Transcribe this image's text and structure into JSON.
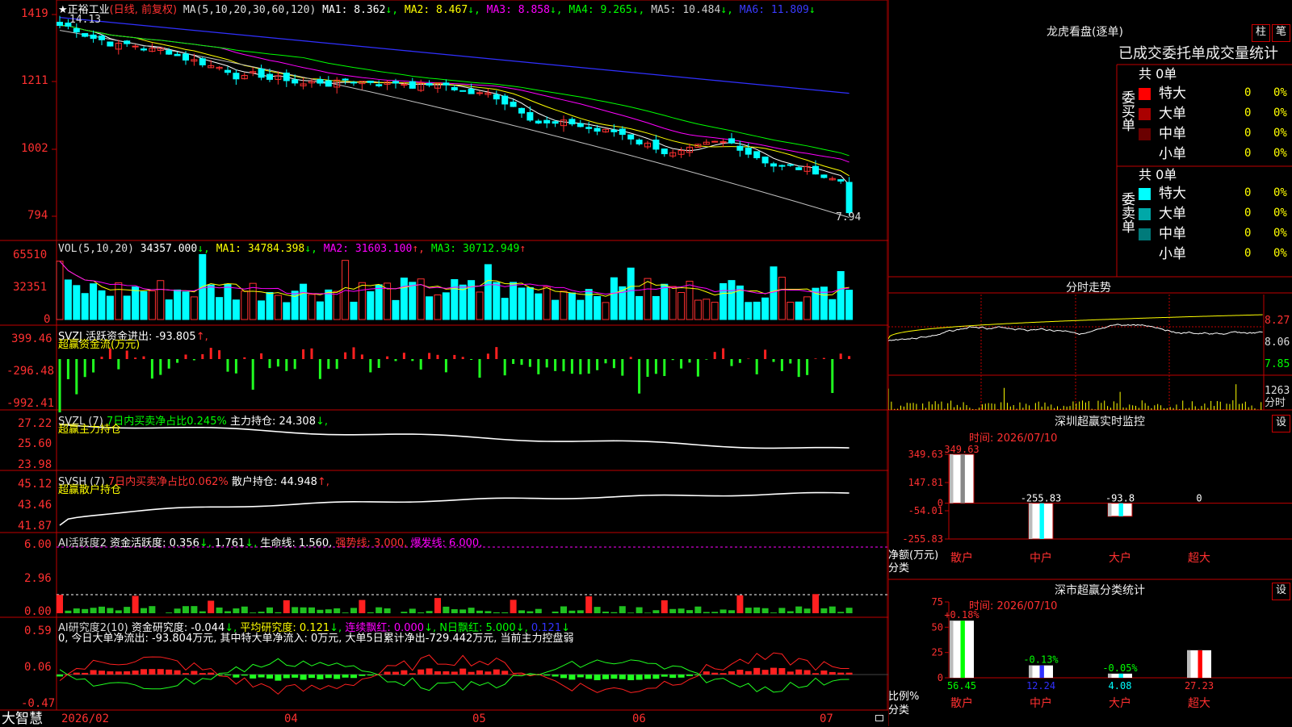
{
  "app": {
    "name": "大智慧"
  },
  "main": {
    "stock_title": "正裕工业",
    "period": "(日线, 前复权)",
    "star": "★",
    "ma_header": "MA(5,10,20,30,60,120)",
    "ma_items": [
      {
        "label": "MA1: 8.362",
        "color": "#ffffff"
      },
      {
        "label": "MA2: 8.467",
        "color": "#ffff00"
      },
      {
        "label": "MA3: 8.858",
        "color": "#ff00ff"
      },
      {
        "label": "MA4: 9.265",
        "color": "#00ff00"
      },
      {
        "label": "MA5: 10.484",
        "color": "#c0c0c0"
      },
      {
        "label": "MA6: 11.809",
        "color": "#3030ff"
      }
    ],
    "y_ticks": [
      "1419",
      "1211",
      "1002",
      "794"
    ],
    "high_marker": "14.13",
    "low_marker": "7.94"
  },
  "vol": {
    "header": "VOL(5,10,20)",
    "value": "34357.000",
    "ma1": "MA1: 34784.398",
    "ma2": "MA2: 31603.100",
    "ma3": "MA3: 30712.949",
    "y_ticks": [
      "65510",
      "32351",
      "0"
    ]
  },
  "svzj": {
    "header": "SVZJ  活跃资金进出: -93.805",
    "subtitle": "超赢资金流(万元)",
    "y_ticks": [
      "399.46",
      "-296.48",
      "-992.41"
    ]
  },
  "svzl": {
    "header": "SVZL (7)",
    "ratio": "7日内买卖净占比0.245%",
    "holding": "主力持仓: 24.308",
    "subtitle": "超赢主力持仓",
    "y_ticks": [
      "27.22",
      "25.60",
      "23.98"
    ]
  },
  "svsh": {
    "header": "SVSH (7)",
    "ratio": "7日内买卖净占比0.062%",
    "holding": "散户持仓: 44.948",
    "subtitle": "超赢散户持仓",
    "y_ticks": [
      "45.12",
      "43.46",
      "41.87"
    ]
  },
  "ai_active": {
    "header": "AI活跃度2",
    "item1": "资金活跃度: 0.356",
    "item2": "1.761",
    "item3": "生命线: 1.560,",
    "item4": "强势线: 3.000,",
    "item5": "爆发线: 6.000,",
    "y_ticks": [
      "6.00",
      "2.96",
      "0.00"
    ]
  },
  "ai_research": {
    "header": "AI研究度2(10)",
    "item1": "资金研究度: -0.044",
    "item2": "平均研究度: 0.121",
    "item3": "连续飘红: 0.000",
    "item4": "N日飘红: 5.000",
    "item5": "0.121",
    "comment": "0, 今日大单净流出: -93.804万元, 其中特大单净流入: 0万元, 大单5日累计净出-729.442万元, 当前主力控盘弱",
    "y_ticks": [
      "0.59",
      "0.06",
      "-0.47"
    ]
  },
  "x_axis": {
    "labels": [
      "2026/02",
      "04",
      "05",
      "06",
      "07"
    ]
  },
  "dragon": {
    "title": "龙虎看盘(逐单)",
    "btn_bar": "柱",
    "btn_pen": "笔",
    "tabs": "已成交委托单成交量统计",
    "buy_side": "委买单",
    "sell_side": "委卖单",
    "buy_total": "共 0单",
    "sell_total": "共 0单",
    "buy_rows": [
      {
        "label": "特大",
        "count": "0",
        "pct": "0%",
        "color": "#ff0000"
      },
      {
        "label": "大单",
        "count": "0",
        "pct": "0%",
        "color": "#aa0000"
      },
      {
        "label": "中单",
        "count": "0",
        "pct": "0%",
        "color": "#6a0000"
      },
      {
        "label": "小单",
        "count": "0",
        "pct": "0%",
        "color": "#000000"
      }
    ],
    "sell_rows": [
      {
        "label": "特大",
        "count": "0",
        "pct": "0%",
        "color": "#00ffff"
      },
      {
        "label": "大单",
        "count": "0",
        "pct": "0%",
        "color": "#00a8a8"
      },
      {
        "label": "中单",
        "count": "0",
        "pct": "0%",
        "color": "#007a7a"
      },
      {
        "label": "小单",
        "count": "0",
        "pct": "0%",
        "color": "#000000"
      }
    ]
  },
  "intraday": {
    "title": "分时走势",
    "price_ticks": [
      "8.27",
      "8.06",
      "7.85"
    ],
    "vol_ticks": [
      "1263",
      "分时"
    ]
  },
  "monitor": {
    "title": "深圳超赢实时监控",
    "btn": "设",
    "time": "时间: 2026/07/10",
    "y_ticks": [
      "349.63",
      "147.81",
      "0",
      "-54.01",
      "-255.83"
    ],
    "unit_label": "净额(万元)",
    "class_label": "分类",
    "categories": [
      "散户",
      "中户",
      "大户",
      "超大"
    ],
    "values": [
      349.63,
      -255.83,
      -93.8,
      0
    ],
    "value_labels": [
      "349.63",
      "-255.83",
      "-93.8",
      "0"
    ]
  },
  "classify": {
    "title": "深市超赢分类统计",
    "btn": "设",
    "time": "时间: 2026/07/10",
    "y_ticks": [
      "75",
      "50",
      "25",
      "0"
    ],
    "unit_label": "比例%",
    "class_label": "分类",
    "categories": [
      "散户",
      "中户",
      "大户",
      "超大"
    ],
    "values": [
      56.45,
      12.24,
      4.08,
      27.23
    ],
    "value_labels": [
      "56.45",
      "12.24",
      "4.08",
      "27.23"
    ],
    "change_labels": [
      "+0.18%",
      "-0.13%",
      "-0.05%",
      ""
    ]
  },
  "chart_data": [
    {
      "type": "line",
      "title": "正裕工业 (日线, 前复权)",
      "ylim": [
        7.94,
        14.19
      ],
      "series": [
        {
          "name": "MA1",
          "values": [
            14.0,
            13.8,
            13.6,
            13.3,
            13.4,
            13.3,
            13.2,
            13.0,
            12.5,
            12.3,
            12.4,
            12.3,
            12.2,
            12.3,
            12.5,
            12.6,
            12.6,
            12.2,
            12.1,
            11.9,
            11.8,
            11.6,
            11.5,
            11.3,
            11.2,
            11.0,
            10.8,
            10.5,
            10.3,
            10.2,
            10.0,
            9.8,
            9.6,
            9.4,
            9.2,
            9.0,
            8.8,
            8.6,
            8.4,
            8.36
          ]
        },
        {
          "name": "MA6",
          "values": [
            14.1,
            14.0,
            13.9,
            13.8,
            13.7,
            13.6,
            13.5,
            13.4,
            13.3,
            13.2,
            13.1,
            13.0,
            12.9,
            12.8,
            12.7,
            12.6,
            12.5,
            12.4,
            12.3,
            12.2,
            12.1,
            12.0,
            11.9,
            11.8
          ]
        }
      ]
    },
    {
      "type": "bar",
      "title": "深圳超赢实时监控",
      "ylabel": "净额(万元)",
      "categories": [
        "散户",
        "中户",
        "大户",
        "超大"
      ],
      "values": [
        349.63,
        -255.83,
        -93.8,
        0
      ],
      "ylim": [
        -255.83,
        349.63
      ]
    },
    {
      "type": "bar",
      "title": "深市超赢分类统计",
      "ylabel": "比例%",
      "categories": [
        "散户",
        "中户",
        "大户",
        "超大"
      ],
      "values": [
        56.45,
        12.24,
        4.08,
        27.23
      ],
      "ylim": [
        0,
        75
      ]
    }
  ]
}
